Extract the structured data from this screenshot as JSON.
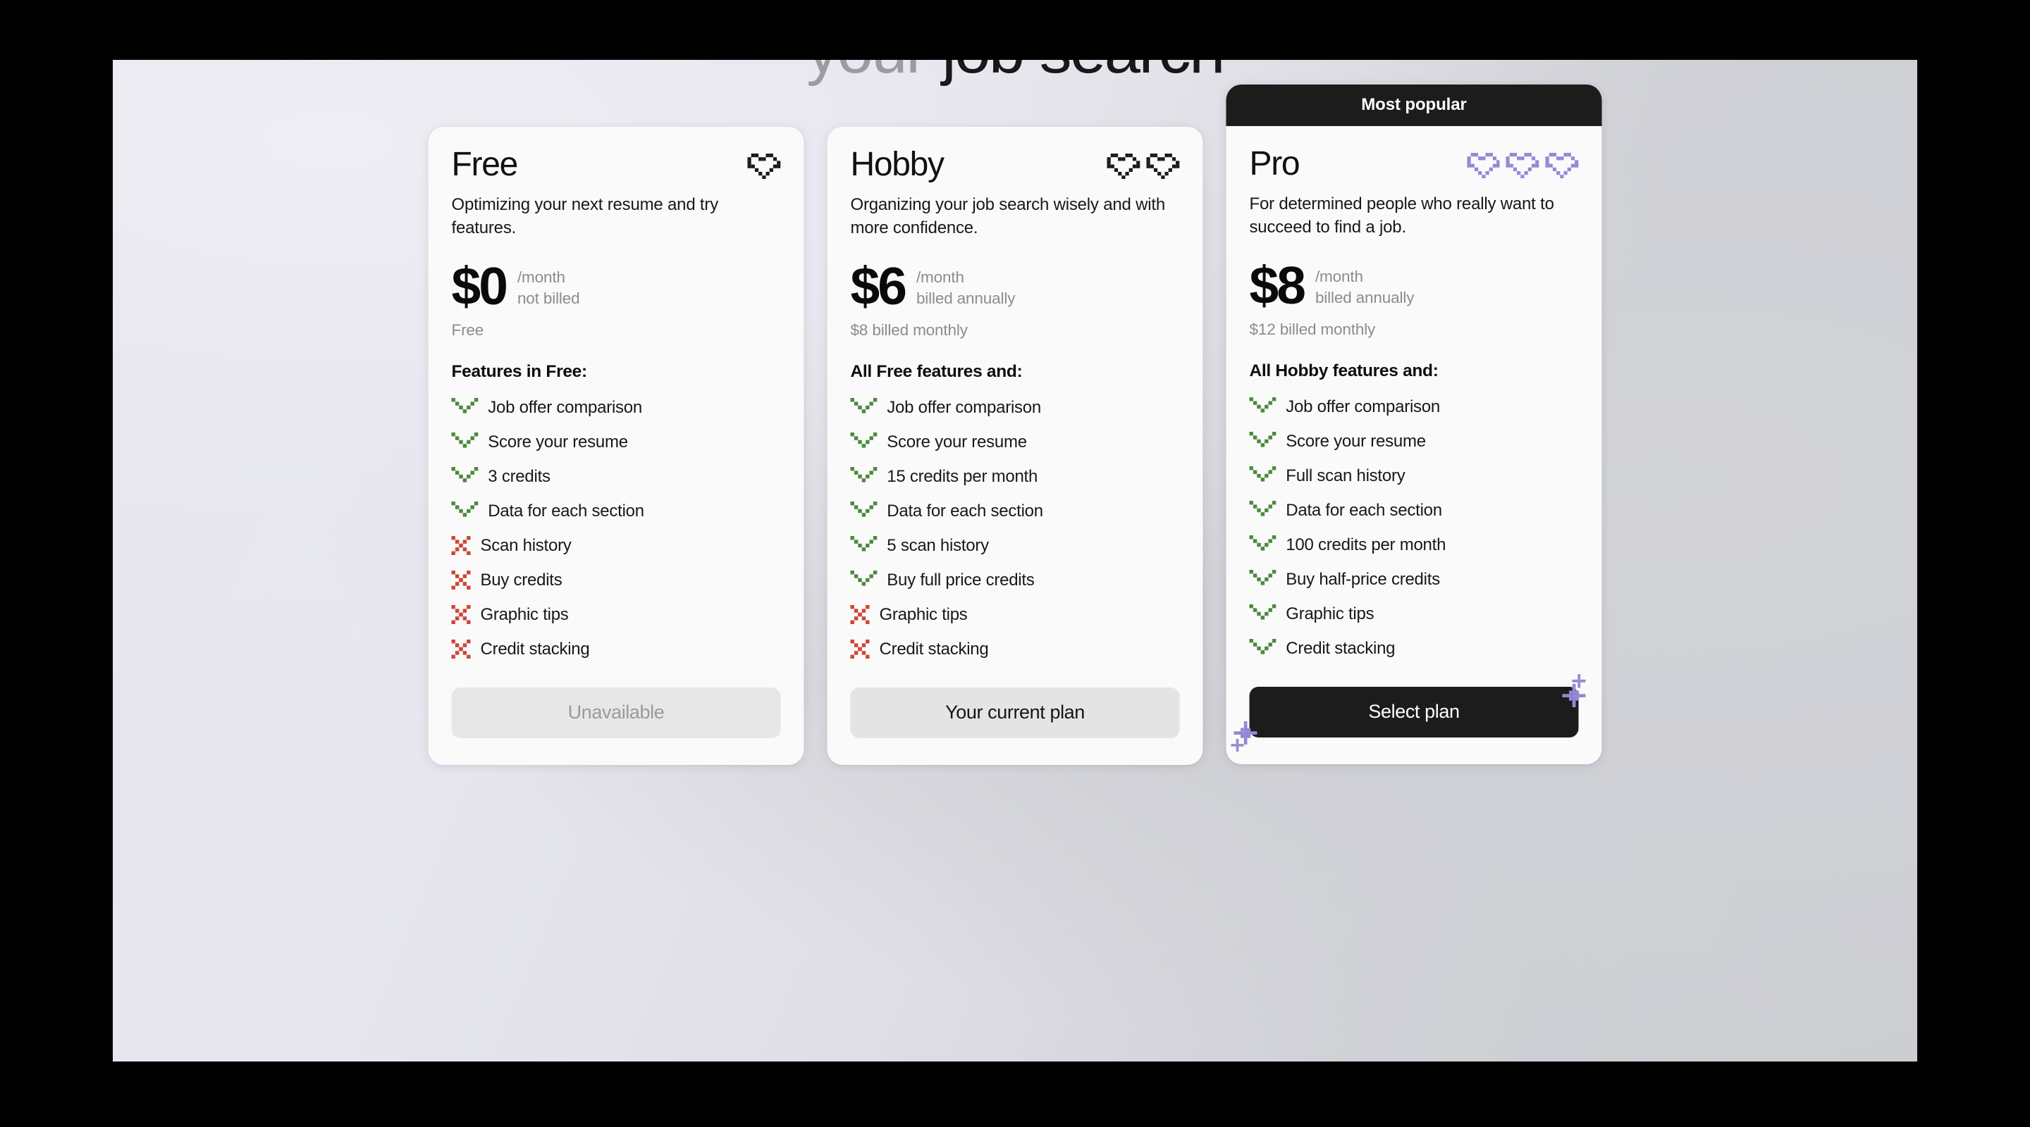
{
  "hero": {
    "line_muted": "your",
    "line_dark": "job search"
  },
  "colors": {
    "accent_purple": "#9289d4",
    "check_green": "#4a8a3c",
    "cross_red": "#cf4435",
    "dark": "#1c1c1c",
    "card_bg": "#fafafa",
    "muted_text": "#8b8b93"
  },
  "plans": [
    {
      "id": "free",
      "name": "Free",
      "ribbon": null,
      "heart_count": 1,
      "heart_color": "#1a1a1a",
      "tagline": "Optimizing your next resume and try features.",
      "price": "$0",
      "price_period": "/month",
      "price_billing": "not billed",
      "billing_note": "Free",
      "features_title": "Features in Free:",
      "features": [
        {
          "label": "Job offer comparison",
          "included": true
        },
        {
          "label": "Score your resume",
          "included": true
        },
        {
          "label": "3 credits",
          "included": true
        },
        {
          "label": "Data for each section",
          "included": true
        },
        {
          "label": "Scan history",
          "included": false
        },
        {
          "label": "Buy credits",
          "included": false
        },
        {
          "label": "Graphic tips",
          "included": false
        },
        {
          "label": "Credit stacking",
          "included": false
        }
      ],
      "cta_label": "Unavailable",
      "cta_style": "disabled",
      "sparkles": false
    },
    {
      "id": "hobby",
      "name": "Hobby",
      "ribbon": null,
      "heart_count": 2,
      "heart_color": "#1a1a1a",
      "tagline": "Organizing your job search wisely and with more confidence.",
      "price": "$6",
      "price_period": "/month",
      "price_billing": "billed annually",
      "billing_note": "$8 billed monthly",
      "features_title": "All Free features and:",
      "features": [
        {
          "label": "Job offer comparison",
          "included": true
        },
        {
          "label": "Score your resume",
          "included": true
        },
        {
          "label": "15 credits per month",
          "included": true
        },
        {
          "label": "Data for each section",
          "included": true
        },
        {
          "label": "5 scan history",
          "included": true
        },
        {
          "label": "Buy full price credits",
          "included": true
        },
        {
          "label": "Graphic tips",
          "included": false
        },
        {
          "label": "Credit stacking",
          "included": false
        }
      ],
      "cta_label": "Your current plan",
      "cta_style": "neutral",
      "sparkles": false
    },
    {
      "id": "pro",
      "name": "Pro",
      "ribbon": "Most popular",
      "heart_count": 3,
      "heart_color": "#9289d4",
      "tagline": "For determined people who really want to succeed to find a job.",
      "price": "$8",
      "price_period": "/month",
      "price_billing": "billed annually",
      "billing_note": "$12 billed monthly",
      "features_title": "All Hobby features and:",
      "features": [
        {
          "label": "Job offer comparison",
          "included": true
        },
        {
          "label": "Score your resume",
          "included": true
        },
        {
          "label": "Full scan history",
          "included": true
        },
        {
          "label": "Data for each section",
          "included": true
        },
        {
          "label": "100 credits per month",
          "included": true
        },
        {
          "label": "Buy half-price credits",
          "included": true
        },
        {
          "label": "Graphic tips",
          "included": true
        },
        {
          "label": "Credit stacking",
          "included": true
        }
      ],
      "cta_label": "Select plan",
      "cta_style": "primary",
      "sparkles": true
    }
  ]
}
